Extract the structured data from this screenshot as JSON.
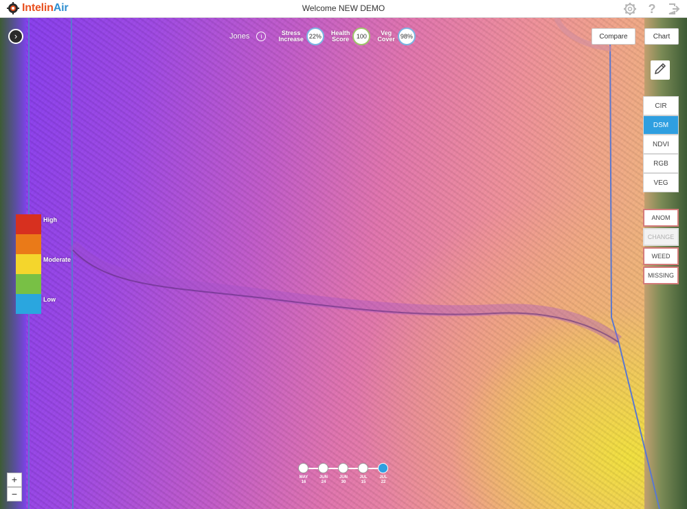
{
  "app": {
    "logo_text_main": "Intelin",
    "logo_text_accent": "Air",
    "welcome": "Welcome NEW DEMO"
  },
  "header_icons": [
    "gear-icon",
    "help-icon",
    "logout-icon"
  ],
  "field": {
    "name": "Jones",
    "stats": [
      {
        "label_line1": "Stress",
        "label_line2": "Increase",
        "value": "22%",
        "ring_color": "#7bb4e3"
      },
      {
        "label_line1": "Health",
        "label_line2": "Score",
        "value": "100",
        "ring_color": "#9fc46b"
      },
      {
        "label_line1": "Veg",
        "label_line2": "Cover",
        "value": "98%",
        "ring_color": "#7bb4e3"
      }
    ]
  },
  "toolbar": {
    "compare": "Compare",
    "chart": "Chart"
  },
  "layers": {
    "items": [
      "CIR",
      "DSM",
      "NDVI",
      "RGB",
      "VEG"
    ],
    "active": "DSM"
  },
  "analysis": {
    "items": [
      {
        "label": "ANOM",
        "enabled": true
      },
      {
        "label": "CHANGE",
        "enabled": false
      },
      {
        "label": "WEED",
        "enabled": true
      },
      {
        "label": "MISSING",
        "enabled": true
      }
    ]
  },
  "legend": {
    "colors": [
      "#d7301f",
      "#ea7a18",
      "#f4d62c",
      "#78c045",
      "#2aa6df"
    ],
    "high": "High",
    "moderate": "Moderate",
    "low": "Low"
  },
  "zoom": {
    "in": "+",
    "out": "−"
  },
  "timeline": {
    "dates": [
      {
        "month": "MAY",
        "day": "16"
      },
      {
        "month": "JUN",
        "day": "24"
      },
      {
        "month": "JUN",
        "day": "30"
      },
      {
        "month": "JUL",
        "day": "15"
      },
      {
        "month": "JUL",
        "day": "22"
      }
    ],
    "active_index": 4
  }
}
